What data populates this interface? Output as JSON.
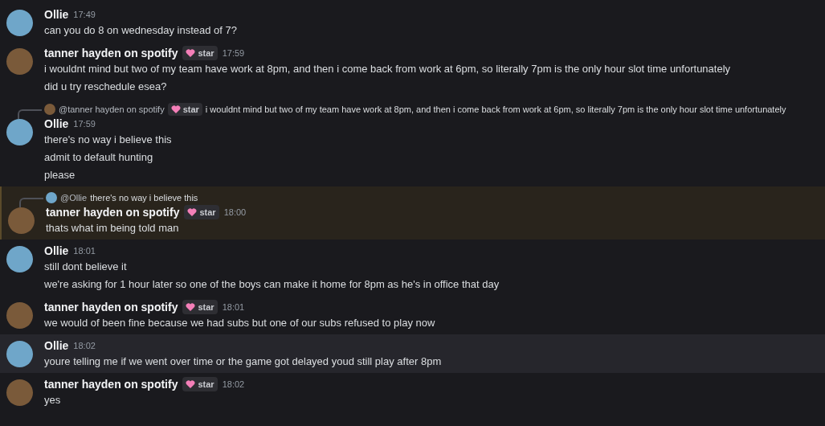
{
  "messages": [
    {
      "author": "Ollie",
      "time": "17:49",
      "color": "#6fa6c9",
      "mentioned": false,
      "hovered": false,
      "lines": [
        "can you do 8 on wednesday instead of 7?"
      ]
    },
    {
      "author": "tanner hayden on spotify",
      "badge": "star",
      "time": "17:59",
      "color": "#7a5a3a",
      "mentioned": false,
      "hovered": false,
      "lines": [
        "i wouldnt mind but two of my team have work at 8pm, and then i come back from work at 6pm, so literally 7pm is the only hour slot time unfortunately",
        "did u try reschedule esea?"
      ]
    },
    {
      "author": "Ollie",
      "time": "17:59",
      "color": "#6fa6c9",
      "mentioned": false,
      "hovered": false,
      "reply": {
        "author": "@tanner hayden on spotify",
        "badge": "star",
        "text": "i wouldnt mind but two of my team have work at 8pm, and then i come back from work at 6pm, so literally 7pm is the only hour slot time unfortunately",
        "color": "#7a5a3a"
      },
      "lines": [
        "there's no way i believe this",
        "admit to default hunting",
        "please"
      ]
    },
    {
      "author": "tanner hayden on spotify",
      "badge": "star",
      "time": "18:00",
      "color": "#7a5a3a",
      "mentioned": true,
      "hovered": false,
      "reply": {
        "author": "@Ollie",
        "text": "there's no way i believe this",
        "color": "#6fa6c9"
      },
      "lines": [
        "thats what im being told man"
      ]
    },
    {
      "author": "Ollie",
      "time": "18:01",
      "color": "#6fa6c9",
      "mentioned": false,
      "hovered": false,
      "lines": [
        "still dont believe it",
        "we're asking for 1 hour later so one of the boys can make it home for 8pm as he's in office that day"
      ]
    },
    {
      "author": "tanner hayden on spotify",
      "badge": "star",
      "time": "18:01",
      "color": "#7a5a3a",
      "mentioned": false,
      "hovered": false,
      "lines": [
        "we would of been fine because we had subs but one of our subs refused to play now"
      ]
    },
    {
      "author": "Ollie",
      "time": "18:02",
      "color": "#6fa6c9",
      "mentioned": false,
      "hovered": true,
      "lines": [
        "youre telling me if we went over time or the game got delayed youd still play after 8pm"
      ]
    },
    {
      "author": "tanner hayden on spotify",
      "badge": "star",
      "time": "18:02",
      "color": "#7a5a3a",
      "mentioned": false,
      "hovered": false,
      "lines": [
        "yes"
      ]
    }
  ]
}
